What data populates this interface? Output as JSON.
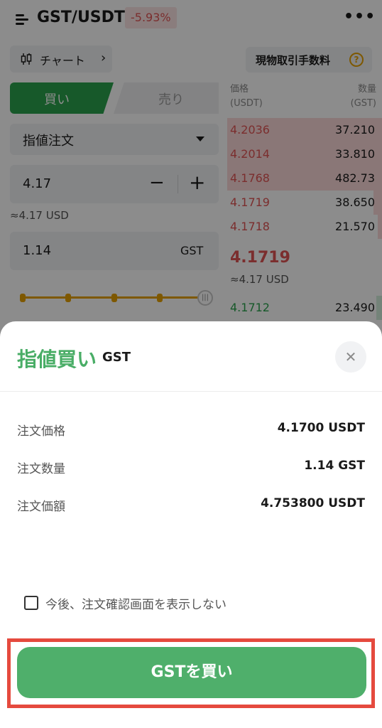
{
  "header": {
    "pair": "GST/USDT",
    "change": "-5.93%",
    "more_icon": "more-horizontal-icon",
    "menu_icon": "menu-icon"
  },
  "toolbar": {
    "chart_label": "チャート",
    "fee_label": "現物取引手数料",
    "fee_help": "?"
  },
  "trade_form": {
    "buy_tab": "買い",
    "sell_tab": "売り",
    "order_type": "指値注文",
    "price": "4.17",
    "price_usd": "≈4.17 USD",
    "quantity": "1.14",
    "quantity_unit": "GST",
    "slider_percent": 100
  },
  "orderbook": {
    "price_header": "価格",
    "price_unit": "(USDT)",
    "qty_header": "数量",
    "qty_unit": "(GST)",
    "asks": [
      {
        "price": "4.2036",
        "qty": "37.210"
      },
      {
        "price": "4.2014",
        "qty": "33.810"
      },
      {
        "price": "4.1768",
        "qty": "482.73"
      },
      {
        "price": "4.1719",
        "qty": "38.650"
      },
      {
        "price": "4.1718",
        "qty": "21.570"
      }
    ],
    "last_price": "4.1719",
    "last_usd": "≈4.17 USD",
    "bids": [
      {
        "price": "4.1712",
        "qty": "23.490"
      }
    ]
  },
  "dialog": {
    "title": "指値買い",
    "symbol": "GST",
    "close_icon": "close-icon",
    "rows": [
      {
        "label": "注文価格",
        "value": "4.1700 USDT"
      },
      {
        "label": "注文数量",
        "value": "1.14 GST"
      },
      {
        "label": "注文価額",
        "value": "4.753800 USDT"
      }
    ],
    "dont_show_label": "今後、注文確認画面を表示しない",
    "buy_button": "GSTを買い"
  },
  "colors": {
    "buy_green": "#2aa34e",
    "sell_red": "#e05454",
    "highlight_red": "#e54a3e",
    "accent_yellow": "#e6a100"
  }
}
